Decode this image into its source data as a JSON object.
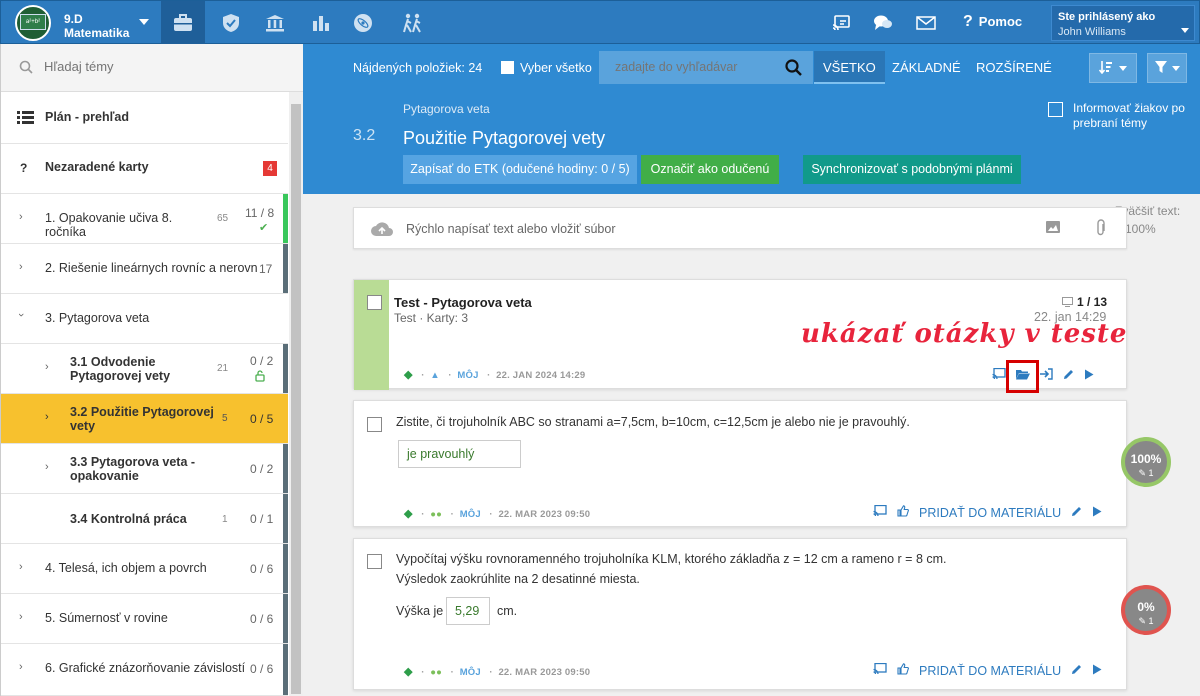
{
  "header": {
    "class_name": "9.D",
    "subject": "Matematika",
    "help": "Pomoc",
    "login_label": "Ste prihlásený ako",
    "user_name": "John Williams",
    "icons": [
      "briefcase-icon",
      "shield-icon",
      "bank-icon",
      "bar-chart-icon",
      "atom-icon",
      "walk-icon",
      "cast-icon",
      "chat-icon",
      "mail-icon"
    ]
  },
  "sidebar": {
    "search_placeholder": "Hľadaj témy",
    "plan": "Plán - prehľad",
    "unassigned": "Nezaradené karty",
    "unassigned_count": "4",
    "items": [
      {
        "label": "1. Opakovanie učiva 8. ročníka",
        "count": "65",
        "fraction": "11 / 8"
      },
      {
        "label": "2. Riešenie lineárnych rovníc a nerovníc",
        "count": "",
        "fraction": "17"
      },
      {
        "label": "3. Pytagorova veta",
        "count": "",
        "fraction": ""
      },
      {
        "label": "3.1 Odvodenie Pytagorovej vety",
        "count": "21",
        "fraction": "0 / 2"
      },
      {
        "label": "3.2 Použitie Pytagorovej vety",
        "count": "5",
        "fraction": "0 / 5"
      },
      {
        "label": "3.3 Pytagorova veta - opakovanie",
        "count": "",
        "fraction": "0 / 2"
      },
      {
        "label": "3.4 Kontrolná práca",
        "count": "1",
        "fraction": "0 / 1"
      },
      {
        "label": "4. Telesá, ich objem a povrch",
        "count": "",
        "fraction": "0 / 6"
      },
      {
        "label": "5. Súmernosť v rovine",
        "count": "",
        "fraction": "0 / 6"
      },
      {
        "label": "6. Grafické znázorňovanie závislostí",
        "count": "",
        "fraction": "0 / 6"
      }
    ]
  },
  "toolbar": {
    "found": "Nájdených položiek: 24",
    "select_all": "Vyber všetko",
    "search_placeholder": "zadajte do vyhľadávar",
    "tabs": [
      "VŠETKO",
      "ZÁKLADNÉ",
      "ROZŠÍRENÉ"
    ]
  },
  "topic": {
    "parent": "Pytagorova veta",
    "number": "3.2",
    "title": "Použitie Pytagorovej vety",
    "inform": "Informovať žiakov po prebraní témy",
    "btn_etk": "Zapísať do ETK (odučené hodiny: 0 / 5)",
    "btn_done": "Označiť ako odučenú",
    "btn_sync": "Synchronizovať s podobnými plánmi"
  },
  "quick_input": {
    "placeholder": "Rýchlo napísať text alebo vložiť súbor",
    "zoom_label": "Zväčšiť text:",
    "zoom_value": "100%"
  },
  "cards": [
    {
      "title": "Test - Pytagorova veta",
      "subtitle": "Test · Karty: 3",
      "count": "1 / 13",
      "date": "22. jan 14:29",
      "owner": "MÔJ",
      "meta_date": "22. JAN 2024 14:29",
      "annotation": "ukázať otázky v teste"
    },
    {
      "question": "Zistite, či trojuholník ABC so stranami a=7,5cm, b=10cm, c=12,5cm je alebo nie je pravouhlý.",
      "answer": "je pravouhlý",
      "owner": "MÔJ",
      "meta_date": "22. MAR 2023 09:50",
      "add": "PRIDAŤ DO MATERIÁLU",
      "score": "100%",
      "score_sub": "1"
    },
    {
      "question": "Vypočítaj výšku rovnoramenného trojuholníka KLM, ktorého základňa z = 12 cm a rameno r = 8 cm.",
      "question2": "Výsledok zaokrúhlite na 2 desatinné miesta.",
      "prefix": "Výška je",
      "answer": "5,29",
      "suffix": "cm.",
      "owner": "MÔJ",
      "meta_date": "22. MAR 2023 09:50",
      "add": "PRIDAŤ DO MATERIÁLU",
      "score": "0%",
      "score_sub": "1"
    }
  ],
  "colors": {
    "primary": "#2f8ad2",
    "green": "#41ae48",
    "teal": "#119a8a",
    "active": "#f7c12e",
    "red": "#d60000"
  }
}
